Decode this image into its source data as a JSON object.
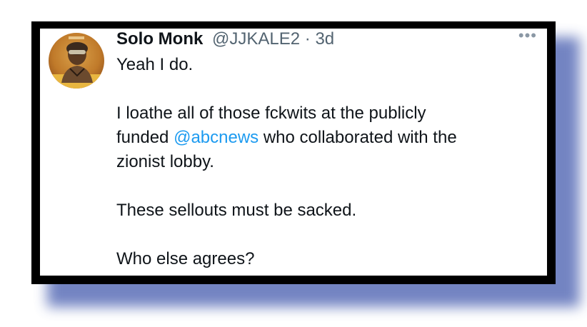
{
  "tweet": {
    "display_name": "Solo Monk",
    "handle": "@JJKALE2",
    "separator": "·",
    "timestamp": "3d",
    "more_icon": "more-dots-icon",
    "more_glyph": "•••",
    "avatar_icon": "profile-avatar-icon",
    "lines": {
      "p1": "Yeah I do.",
      "p2_line1": "I loathe all of those fckwits at the publicly",
      "p2_line2_pre": "funded ",
      "p2_mention": "@abcnews",
      "p2_line2_post": " who collaborated with the",
      "p2_line3": "zionist lobby.",
      "p3": "These sellouts must be sacked.",
      "p4": "Who else agrees?"
    }
  },
  "colors": {
    "frame": "#000000",
    "shadow": "#5b6fb8",
    "text": "#0f1419",
    "secondary_text": "#536471",
    "mention": "#1d9bf0"
  }
}
